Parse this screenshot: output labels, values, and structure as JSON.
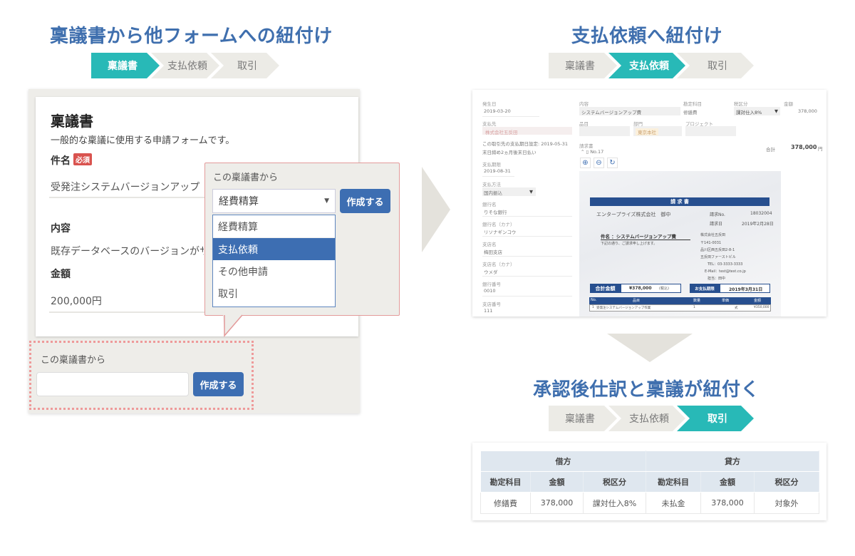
{
  "left_section": {
    "title": "稟議書から他フォームへの紐付け",
    "steps": [
      "稟議書",
      "支払依頼",
      "取引"
    ],
    "active_step": 0,
    "form": {
      "title": "稟議書",
      "description": "一般的な稟議に使用する申請フォームです。",
      "fields": [
        {
          "label": "件名",
          "required_badge": "必須",
          "value": "受発注システムバージョンアップ"
        },
        {
          "label": "内容",
          "value": "既存データベースのバージョンがサポ"
        },
        {
          "label": "金額",
          "value": "200,000円"
        }
      ]
    },
    "link_box": {
      "label": "この稟議書から",
      "input_value": "",
      "button_label": "作成する"
    },
    "popup": {
      "label": "この稟議書から",
      "selected_value": "経費精算",
      "button_label": "作成する",
      "options": [
        "経費精算",
        "支払依頼",
        "その他申請",
        "取引"
      ],
      "highlighted_option": "支払依頼"
    }
  },
  "right_top_section": {
    "title": "支払依頼へ紐付け",
    "steps": [
      "稟議書",
      "支払依頼",
      "取引"
    ],
    "active_step": 1,
    "payment_form": {
      "left_fields": [
        {
          "label": "発生日",
          "value": "2019-03-20"
        },
        {
          "label": "支払先",
          "value": "株式会社五反田"
        },
        {
          "label": "この取引先の支払期日設定: 2019-05-31",
          "value": "末日締め2ヵ月後末日払い"
        },
        {
          "label": "支払期限",
          "value": "2019-08-31"
        },
        {
          "label": "支払方法",
          "value": "国内振込"
        },
        {
          "label": "銀行名",
          "value": "りそな銀行"
        },
        {
          "label": "銀行名（カナ）",
          "value": "リソナギンコウ"
        },
        {
          "label": "支店名",
          "value": "梅田支店"
        },
        {
          "label": "支店名（カナ）",
          "value": "ウメダ"
        },
        {
          "label": "銀行番号",
          "value": "0010"
        },
        {
          "label": "支店番号",
          "value": "111"
        }
      ],
      "content_label": "内容",
      "content_value": "システムバージョンアップ費",
      "account_label": "勘定科目",
      "account_value": "修繕費",
      "tax_label": "税区分",
      "tax_value": "課対仕入8%",
      "amount_label": "金額",
      "amount_value": "378,000",
      "item_label": "品目",
      "dept_label": "部門",
      "dept_value": "東京本社",
      "project_label": "プロジェクト",
      "invoice_label": "請求書",
      "invoice_no": "No.17",
      "total_label": "合計",
      "total_value": "378,000",
      "total_unit": "円",
      "invoice_image": {
        "heading": "請 求 書",
        "to": "エンタープライズ株式会社　御中",
        "no_label": "請求No.",
        "no_value": "18032004",
        "date_label": "請求日",
        "date_value": "2019年2月28日",
        "subject": "件名 ：システムバージョンアップ費",
        "note": "下記の通り、ご請求申し上げます。",
        "issuer": [
          "株式会社五反田",
          "〒141-0031",
          "品川区西五反田2-8-1",
          "五反田ファーストビル",
          "TEL：03-3333-3333",
          "E-Mail：test@test.co.jp",
          "担当：田中"
        ],
        "total_label": "合計金額",
        "total_value": "¥378,000",
        "tax_note": "(税込)",
        "due_label": "お支払期限",
        "due_value": "2019年3月31日",
        "columns": [
          "No.",
          "品目",
          "数量",
          "単価",
          "金額"
        ],
        "row": [
          "1",
          "受発注システムバージョンアップ作業",
          "1",
          "式",
          "¥350,000"
        ]
      }
    }
  },
  "right_bottom_section": {
    "title": "承認後仕訳と稟議が紐付く",
    "steps": [
      "稟議書",
      "支払依頼",
      "取引"
    ],
    "active_step": 2,
    "journal": {
      "debit_label": "借方",
      "credit_label": "貸方",
      "columns": [
        "勘定科目",
        "金額",
        "税区分",
        "勘定科目",
        "金額",
        "税区分"
      ],
      "rows": [
        [
          "修繕費",
          "378,000",
          "課対仕入8%",
          "未払金",
          "378,000",
          "対象外"
        ]
      ]
    }
  },
  "colors": {
    "title_blue": "#3f6fae",
    "step_active": "#28b9b7",
    "step_inactive": "#ecebe6",
    "button_blue": "#3d6eb2",
    "required_red": "#d9534f",
    "popup_border": "#e39a9a"
  }
}
